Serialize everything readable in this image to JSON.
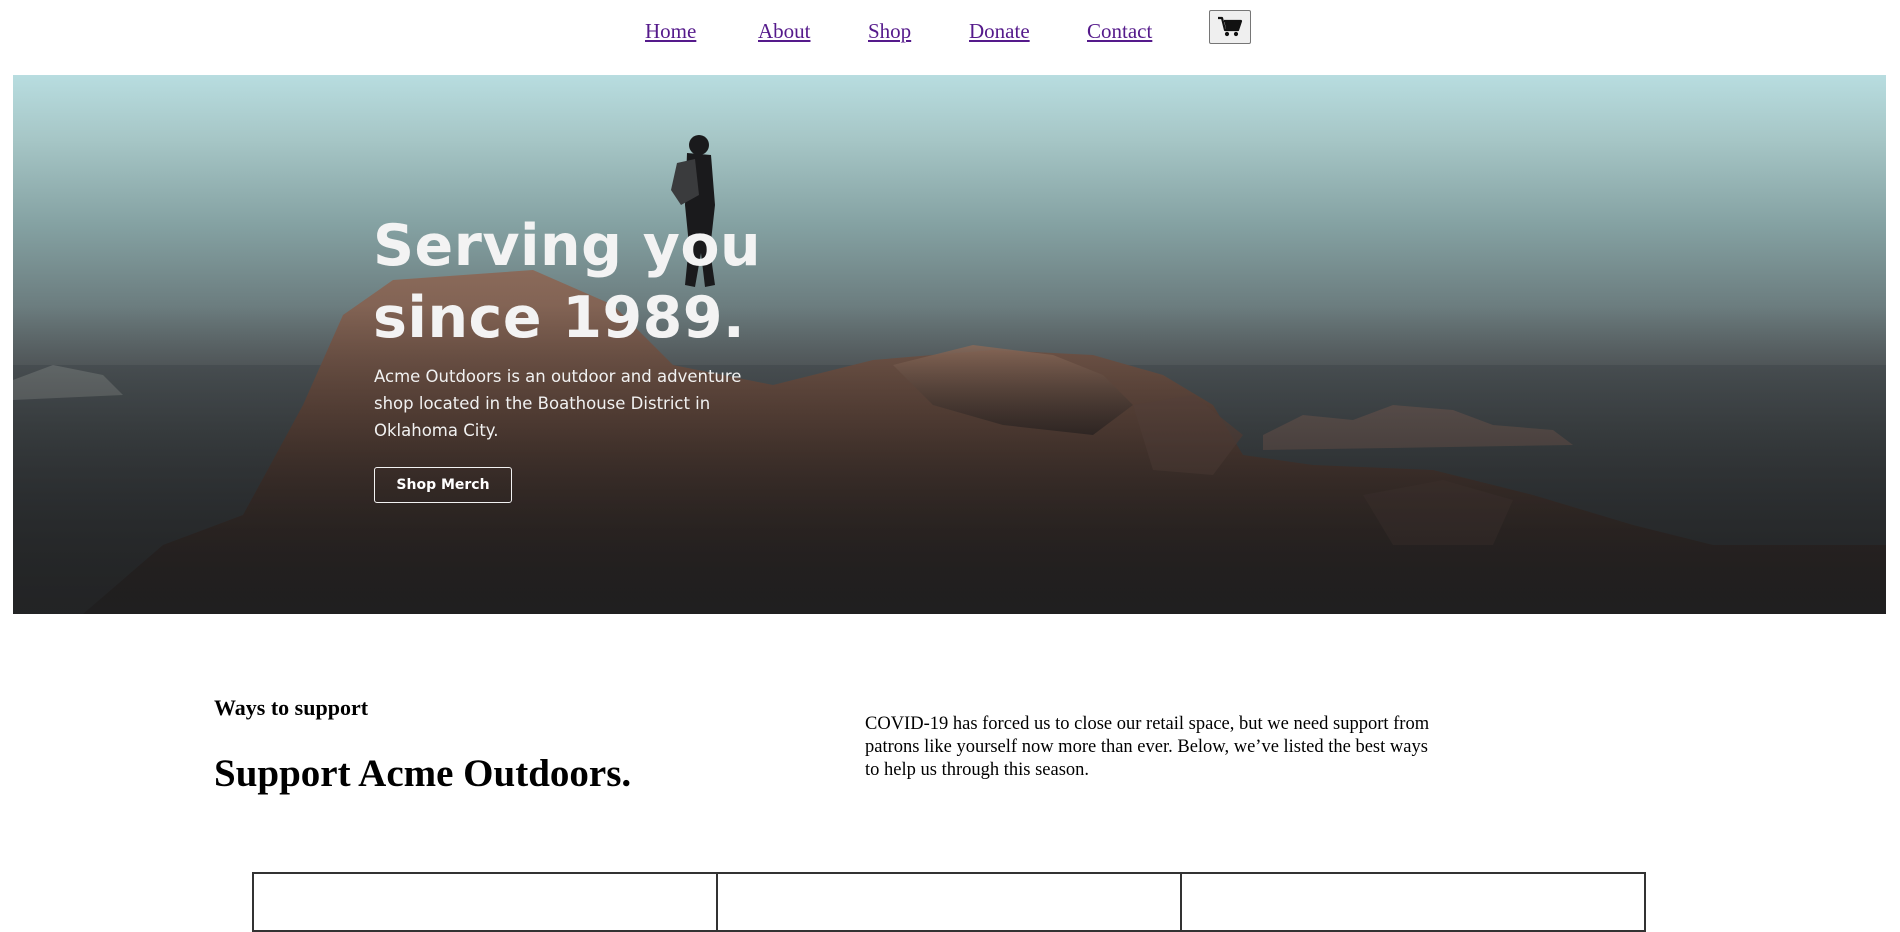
{
  "nav": {
    "links": [
      "Home",
      "About",
      "Shop",
      "Donate",
      "Contact"
    ],
    "cart_icon": "shopping-cart-icon",
    "link_color": "#551a8b"
  },
  "hero": {
    "title": "Serving you since 1989.",
    "description": "Acme Outdoors is an outdoor and adventure shop located in the Boathouse District in Oklahoma City.",
    "button_label": "Shop Merch"
  },
  "support": {
    "eyebrow": "Ways to support",
    "title": "Support Acme Outdoors.",
    "copy": "COVID-19 has forced us to close our retail space, but we need support from patrons like yourself now more than ever. Below, we’ve listed the best ways to help us through this season."
  }
}
